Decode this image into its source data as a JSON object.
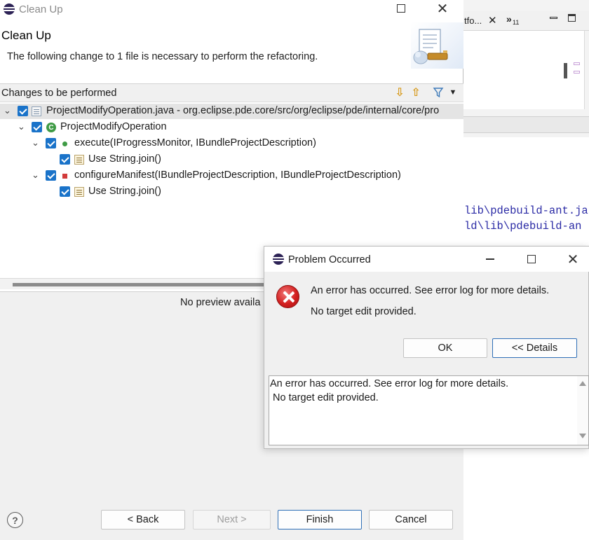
{
  "background_editor": {
    "tab_label": "tfo...",
    "tab_overflow": "»",
    "tab_overflow_count": "11",
    "code_lines": [
      "lib\\pdebuild-ant.ja",
      "ld\\lib\\pdebuild-an"
    ]
  },
  "cleanup_dialog": {
    "window_title": "Clean Up",
    "heading": "Clean Up",
    "description": "The following change to 1 file is necessary to perform the refactoring.",
    "changes_label": "Changes to be performed",
    "tree": [
      {
        "label": "ProjectModifyOperation.java - org.eclipse.pde.core/src/org/eclipse/pde/internal/core/pro"
      },
      {
        "label": "ProjectModifyOperation"
      },
      {
        "label": "execute(IProgressMonitor, IBundleProjectDescription)"
      },
      {
        "label": "Use String.join()"
      },
      {
        "label": "configureManifest(IBundleProjectDescription, IBundleProjectDescription)"
      },
      {
        "label": "Use String.join()"
      }
    ],
    "preview_text": "No preview availa",
    "help_label": "?",
    "buttons": {
      "back": "< Back",
      "next": "Next >",
      "finish": "Finish",
      "cancel": "Cancel"
    }
  },
  "problem_dialog": {
    "window_title": "Problem Occurred",
    "message": "An error has occurred. See error log for more details.",
    "reason": "No target edit provided.",
    "ok_label": "OK",
    "details_label": "<< Details",
    "details_lines": [
      "An error has occurred. See error log for more details.",
      " No target edit provided."
    ]
  }
}
